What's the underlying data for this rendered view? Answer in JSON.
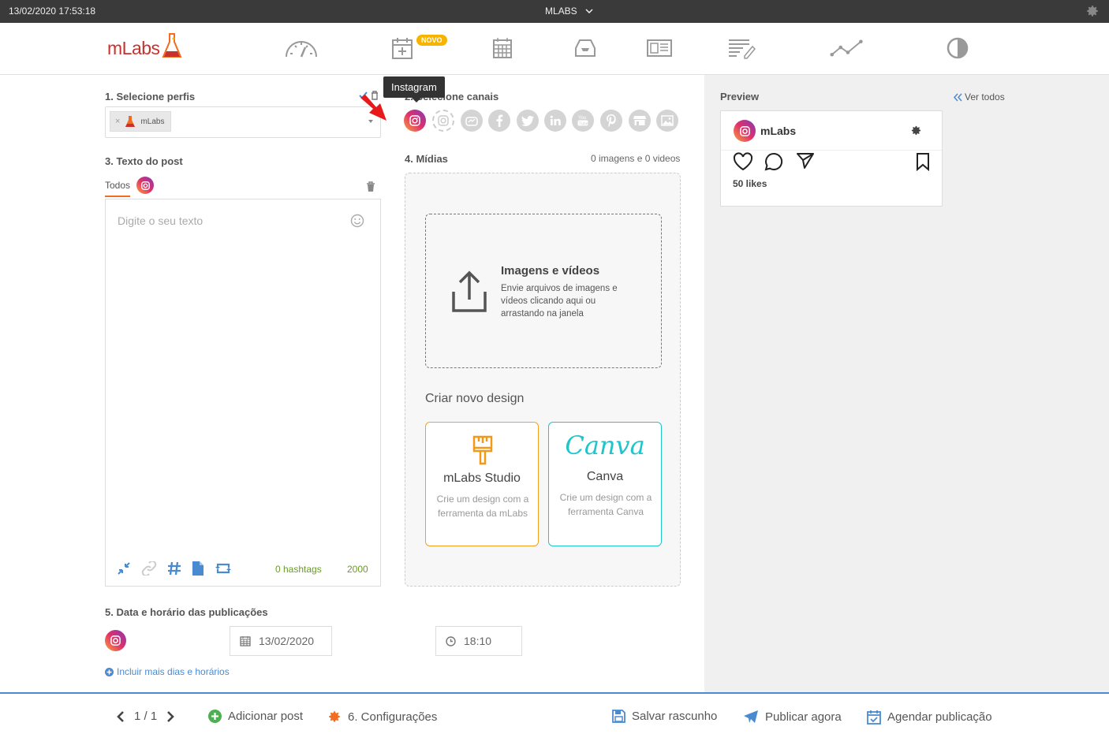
{
  "sysbar": {
    "datetime": "13/02/2020 17:53:18",
    "account": "MLABS"
  },
  "nav": {
    "logo_text": "mLabs",
    "badge_novo": "NOVO"
  },
  "tooltip": "Instagram",
  "profiles": {
    "title": "1. Selecione perfis",
    "chip_label": "mLabs"
  },
  "channels": {
    "title": "2. Selecione canais"
  },
  "post_text": {
    "title": "3. Texto do post",
    "tab_all": "Todos",
    "placeholder": "Digite o seu texto",
    "hashtags": "0 hashtags",
    "chars_left": "2000"
  },
  "media": {
    "title": "4. Mídias",
    "count": "0 imagens e 0 videos",
    "upload_title": "Imagens e vídeos",
    "upload_desc": "Envie arquivos de imagens e vídeos clicando aqui ou arrastando na janela",
    "design_heading": "Criar novo design",
    "studio_name": "mLabs Studio",
    "studio_desc": "Crie um design com a ferramenta da mLabs",
    "canva_logo": "Canva",
    "canva_name": "Canva",
    "canva_desc": "Crie um design com a ferramenta Canva"
  },
  "schedule": {
    "title": "5. Data e horário das publicações",
    "date": "13/02/2020",
    "time": "18:10",
    "add_more": "Incluir mais dias e horários"
  },
  "preview": {
    "title": "Preview",
    "see_all": "Ver todos",
    "profile_name": "mLabs",
    "likes": "50 likes"
  },
  "footer": {
    "pager": "1 / 1",
    "add_post": "Adicionar post",
    "settings": "6. Configurações",
    "save_draft": "Salvar rascunho",
    "publish_now": "Publicar agora",
    "schedule": "Agendar publicação"
  },
  "colors": {
    "accent_orange": "#f26c21",
    "link_blue": "#4a8ad0",
    "counter_green": "#6a9b2b",
    "canva_teal": "#20c4cb",
    "logo_red": "#c7322f"
  }
}
